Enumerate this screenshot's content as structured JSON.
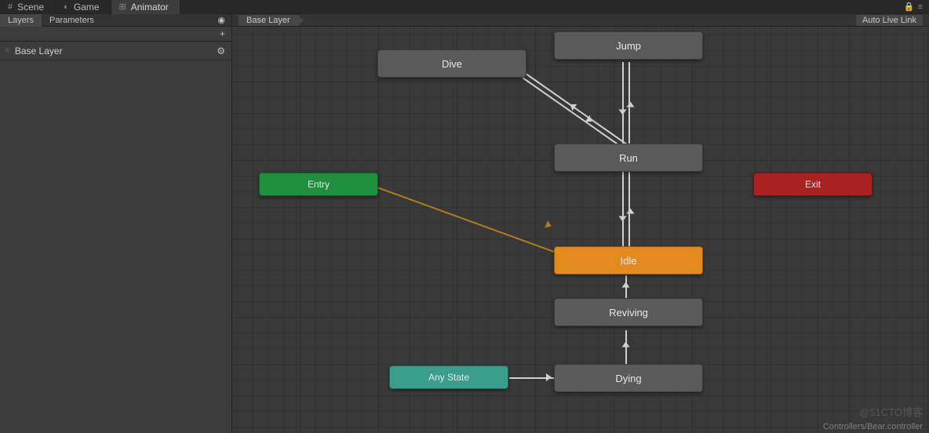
{
  "tabs": {
    "scene": "Scene",
    "game": "Game",
    "animator": "Animator"
  },
  "icons": {
    "lock": "🔒",
    "menu": "≡",
    "eye": "◉",
    "plus": "+",
    "drag": "≡",
    "gear": "⚙"
  },
  "side": {
    "tabLayers": "Layers",
    "tabParameters": "Parameters",
    "layer0": "Base Layer"
  },
  "breadcrumb": {
    "main": "Base Layer",
    "autolink": "Auto Live Link"
  },
  "nodes": {
    "dive": "Dive",
    "jump": "Jump",
    "run": "Run",
    "idle": "Idle",
    "reviving": "Reviving",
    "dying": "Dying",
    "entry": "Entry",
    "exit": "Exit",
    "anyState": "Any State"
  },
  "footer": {
    "path": "Controllers/Bear.controller"
  },
  "watermark": "@51CTO博客"
}
